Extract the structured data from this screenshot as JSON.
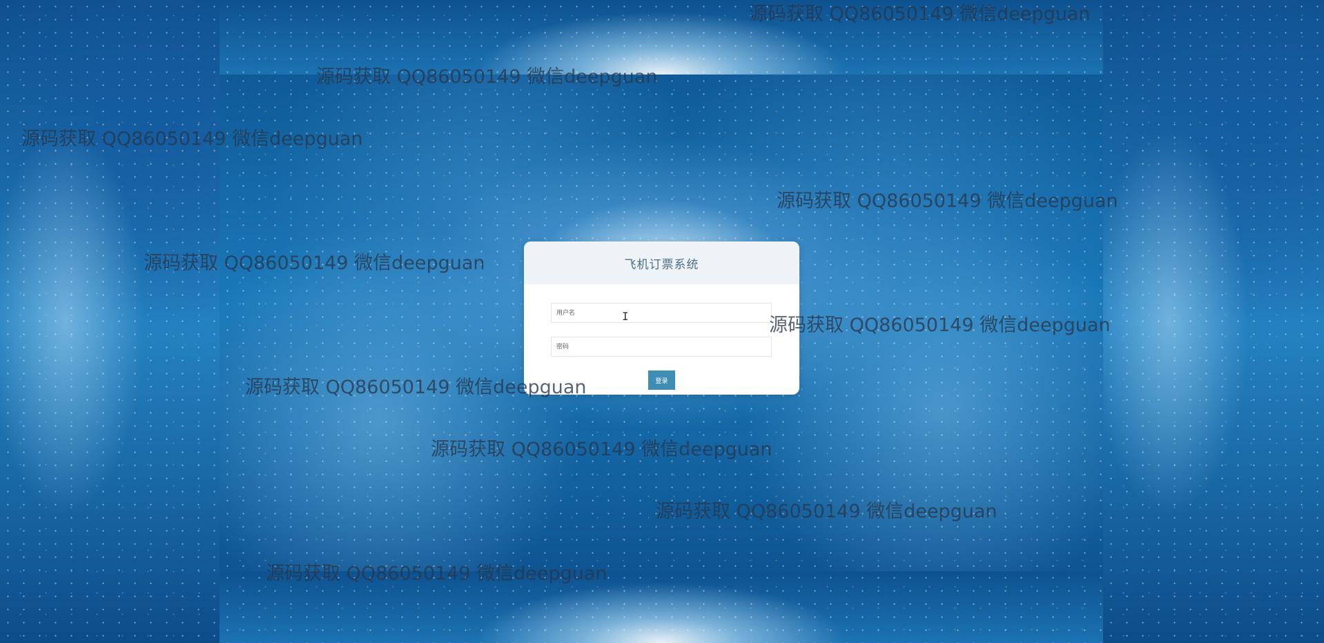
{
  "app": {
    "title": "飞机订票系统"
  },
  "login": {
    "username_placeholder": "用户名",
    "username_value": "",
    "password_placeholder": "密码",
    "password_value": "",
    "submit_label": "登录"
  },
  "watermark": {
    "text": "源码获取 QQ86050149 微信deepguan"
  },
  "colors": {
    "accent": "#3d8db5",
    "header_bg": "#eef3f7",
    "title_text": "#4c6f87",
    "page_bg": "#0d4b86"
  },
  "icons": {
    "cursor": "text-cursor-icon"
  }
}
